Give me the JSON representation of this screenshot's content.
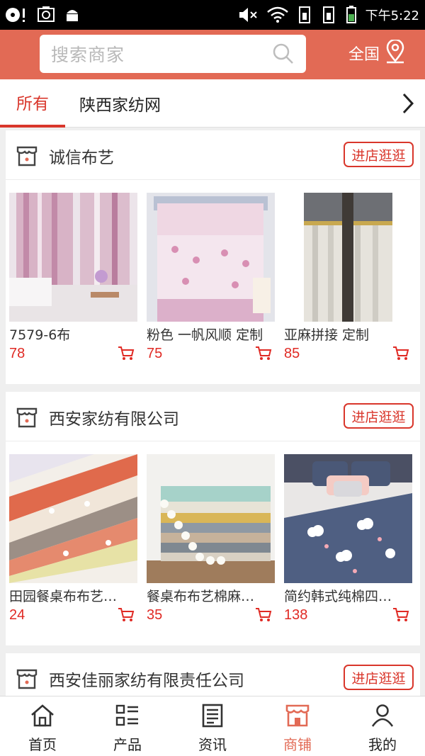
{
  "status_bar": {
    "time": "下午5:22"
  },
  "header": {
    "search_placeholder": "搜索商家",
    "region_label": "全国"
  },
  "tabs": [
    {
      "label": "所有",
      "active": true
    },
    {
      "label": "陕西家纺网",
      "active": false
    }
  ],
  "colors": {
    "brand": "#e26a55",
    "accent_red": "#d9362b",
    "price_red": "#e02a24"
  },
  "shops": [
    {
      "name": "诚信布艺",
      "visit_label": "进店逛逛",
      "products": [
        {
          "name": "7579-6布",
          "price": "78"
        },
        {
          "name": "粉色 一帆风顺 定制",
          "price": "75"
        },
        {
          "name": "亚麻拼接 定制",
          "price": "85"
        }
      ]
    },
    {
      "name": "西安家纺有限公司",
      "visit_label": "进店逛逛",
      "products": [
        {
          "name": "田园餐桌布布艺…",
          "price": "24"
        },
        {
          "name": "餐桌布布艺棉麻…",
          "price": "35"
        },
        {
          "name": "简约韩式纯棉四…",
          "price": "138"
        }
      ]
    },
    {
      "name": "西安佳丽家纺有限责任公司",
      "visit_label": "进店逛逛",
      "products": []
    }
  ],
  "bottom_nav": [
    {
      "label": "首页",
      "icon": "home-icon",
      "active": false
    },
    {
      "label": "产品",
      "icon": "product-list-icon",
      "active": false
    },
    {
      "label": "资讯",
      "icon": "news-icon",
      "active": false
    },
    {
      "label": "商铺",
      "icon": "store-icon",
      "active": true
    },
    {
      "label": "我的",
      "icon": "user-icon",
      "active": false
    }
  ]
}
